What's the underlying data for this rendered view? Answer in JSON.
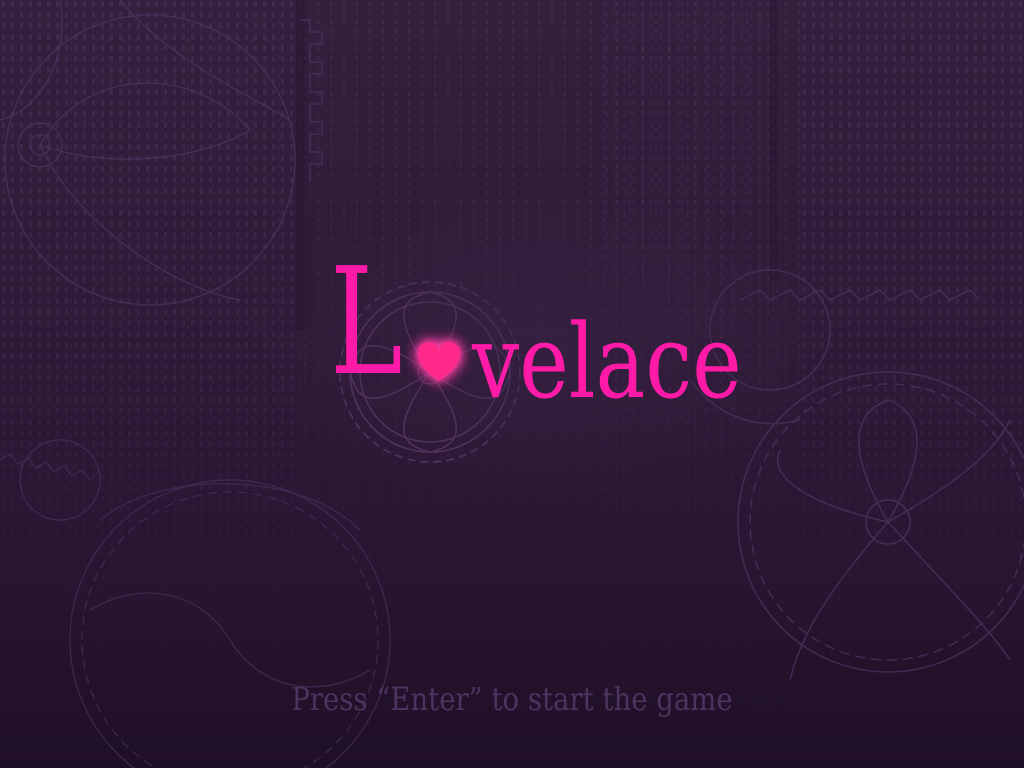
{
  "game": {
    "title_first_letter": "L",
    "title_heart_icon": "heart-icon",
    "title_rest": "velace",
    "start_prompt": "Press “Enter” to start the game"
  },
  "colors": {
    "background": "#2f1b37",
    "title": "#ff1aa8",
    "heart": "#ff2a8a",
    "prompt": "#4a3560",
    "gear_lines": "#4a3258",
    "matrix_rain": "#4a3558"
  },
  "background": {
    "style": "falling binary code rain with clockwork gears",
    "icons": [
      "gear-icon",
      "matrix-rain"
    ]
  }
}
